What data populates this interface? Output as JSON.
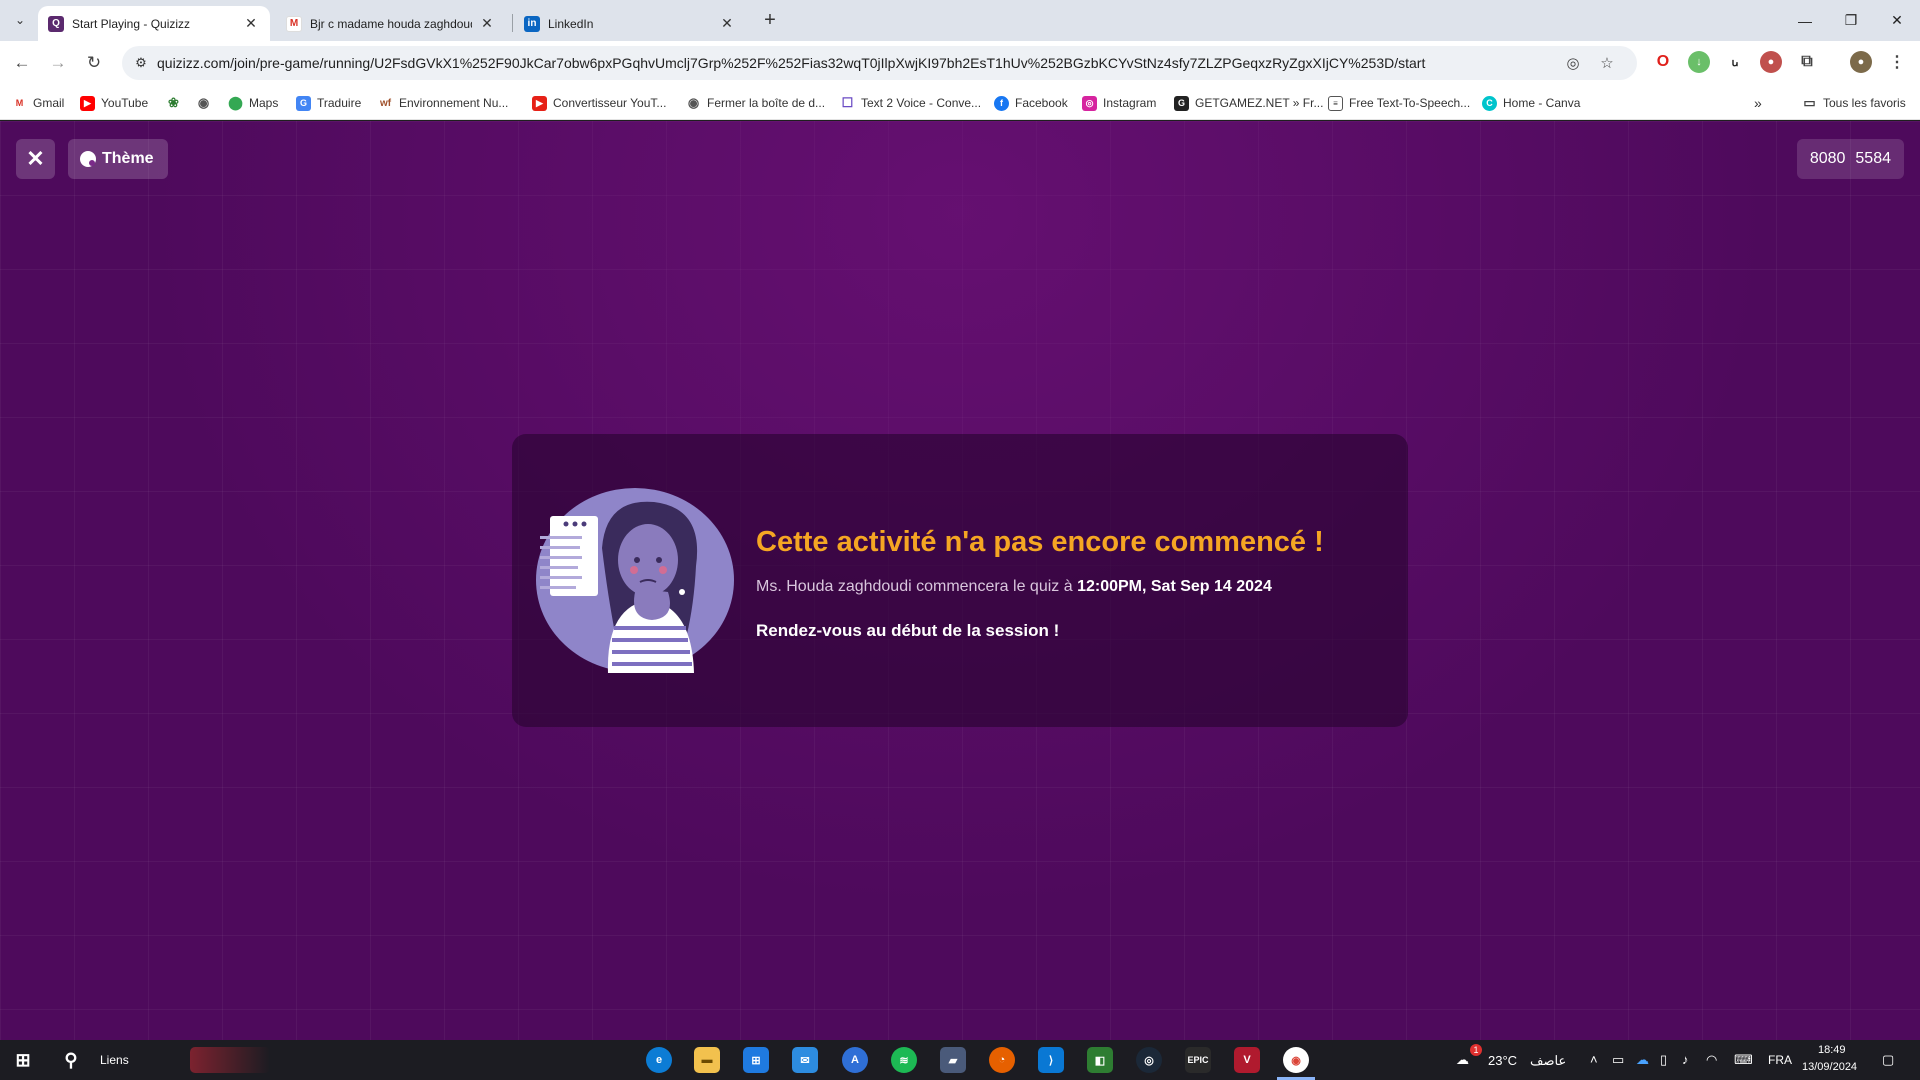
{
  "browser": {
    "tabs": [
      {
        "title": "Start Playing - Quizizz",
        "favicon": "quizizz-icon",
        "active": true
      },
      {
        "title": "Bjr c madame houda zaghdoudi",
        "favicon": "gmail-icon",
        "active": false
      },
      {
        "title": "LinkedIn",
        "favicon": "linkedin-icon",
        "active": false
      }
    ],
    "url": "quizizz.com/join/pre-game/running/U2FsdGVkX1%252F90JkCar7obw6pxPGqhvUmclj7Grp%252F%252Fias32wqT0jIlpXwjKI97bh2EsT1hUv%252BGzbKCYvStNz4sfy7ZLZPGeqxzRyZgxXIjCY%253D/start",
    "bookmarks": [
      {
        "label": "Gmail",
        "icon": "gmail-icon"
      },
      {
        "label": "YouTube",
        "icon": "youtube-icon"
      },
      {
        "label": "",
        "icon": "leaf-icon"
      },
      {
        "label": "",
        "icon": "globe-icon"
      },
      {
        "label": "Maps",
        "icon": "maps-icon"
      },
      {
        "label": "Traduire",
        "icon": "translate-icon"
      },
      {
        "label": "Environnement Nu...",
        "icon": "environment-icon"
      },
      {
        "label": "Convertisseur YouT...",
        "icon": "youtube-converter-icon"
      },
      {
        "label": "Fermer la boîte de d...",
        "icon": "globe-icon"
      },
      {
        "label": "Text 2 Voice - Conve...",
        "icon": "chat-icon"
      },
      {
        "label": "Facebook",
        "icon": "facebook-icon"
      },
      {
        "label": "Instagram",
        "icon": "instagram-icon"
      },
      {
        "label": "GETGAMEZ.NET » Fr...",
        "icon": "getgamez-icon"
      },
      {
        "label": "Free Text-To-Speech...",
        "icon": "tts-icon"
      },
      {
        "label": "Home - Canva",
        "icon": "canva-icon"
      }
    ],
    "all_bookmarks": "Tous les favoris"
  },
  "page": {
    "theme_label": "Thème",
    "game_code": [
      "8080",
      "5584"
    ],
    "card": {
      "title": "Cette activité n'a pas encore commencé !",
      "sub_prefix": "Ms. Houda zaghdoudi commencera le quiz à ",
      "sub_time": "12:00PM, Sat Sep 14 2024",
      "message": "Rendez-vous au début de la session !"
    }
  },
  "taskbar": {
    "search_label": "Liens",
    "weather": "23°C",
    "weather_desc": "عاصف",
    "notif_count": "1",
    "language": "FRA",
    "time": "18:49",
    "date": "13/09/2024"
  },
  "colors": {
    "page_bg": "#4e0a5c",
    "title_accent": "#f5a623",
    "card_bg": "#2d0336"
  }
}
